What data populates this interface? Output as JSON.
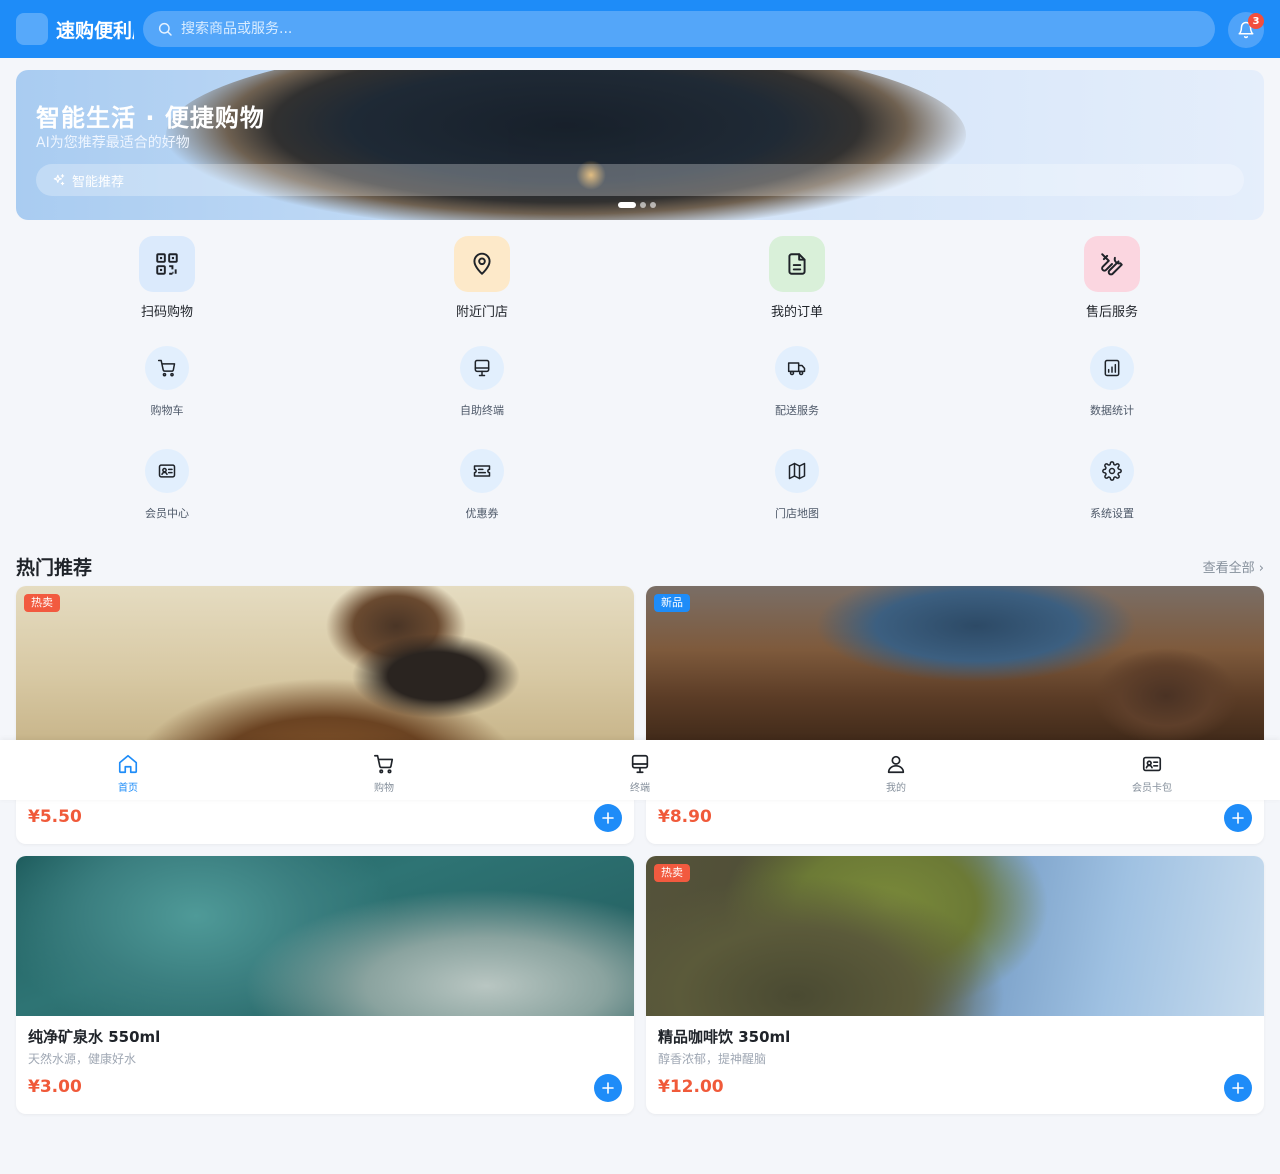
{
  "header": {
    "app_title": "速购便利店",
    "search_placeholder": "搜索商品或服务...",
    "notification_count": "3",
    "colors": {
      "primary": "#1e8cf8",
      "badge": "#f24f3d"
    }
  },
  "banner": {
    "title": "智能生活 · 便捷购物",
    "subtitle": "AI为您推荐最适合的好物",
    "ai_button": "智能推荐",
    "slide_count": 3,
    "active_slide": 1
  },
  "primary_features": [
    {
      "label": "扫码购物",
      "icon": "qrcode-icon"
    },
    {
      "label": "附近门店",
      "icon": "map-pin-icon"
    },
    {
      "label": "我的订单",
      "icon": "document-icon"
    },
    {
      "label": "售后服务",
      "icon": "tools-icon"
    }
  ],
  "secondary_features": [
    {
      "label": "购物车",
      "icon": "cart-icon"
    },
    {
      "label": "自助终端",
      "icon": "monitor-icon"
    },
    {
      "label": "配送服务",
      "icon": "truck-icon"
    },
    {
      "label": "数据统计",
      "icon": "chart-icon"
    },
    {
      "label": "会员中心",
      "icon": "id-card-icon"
    },
    {
      "label": "优惠券",
      "icon": "ticket-icon"
    },
    {
      "label": "门店地图",
      "icon": "map-icon"
    },
    {
      "label": "系统设置",
      "icon": "gear-icon"
    }
  ],
  "section": {
    "title": "热门推荐",
    "view_all": "查看全部 ›"
  },
  "products": [
    {
      "tag": "热卖",
      "tag_color": "#f25a3f",
      "name": "",
      "desc": "",
      "price": "¥5.50",
      "image": "scarf-photo"
    },
    {
      "tag": "新品",
      "tag_color": "#1e8cf8",
      "name": "",
      "desc": "",
      "price": "¥8.90",
      "image": "boot-photo"
    },
    {
      "tag": "",
      "tag_color": "",
      "name": "纯净矿泉水 550ml",
      "desc": "天然水源，健康好水",
      "price": "¥3.00",
      "image": "wave-photo"
    },
    {
      "tag": "热卖",
      "tag_color": "#f25a3f",
      "name": "精品咖啡饮 350ml",
      "desc": "醇香浓郁，提神醒脑",
      "price": "¥12.00",
      "image": "cliff-photo"
    }
  ],
  "bottom_nav": [
    {
      "label": "首页",
      "icon": "home-icon",
      "active": true
    },
    {
      "label": "购物",
      "icon": "cart-icon",
      "active": false
    },
    {
      "label": "终端",
      "icon": "monitor-icon",
      "active": false
    },
    {
      "label": "我的",
      "icon": "user-icon",
      "active": false
    },
    {
      "label": "会员卡包",
      "icon": "id-card-icon",
      "active": false
    }
  ]
}
